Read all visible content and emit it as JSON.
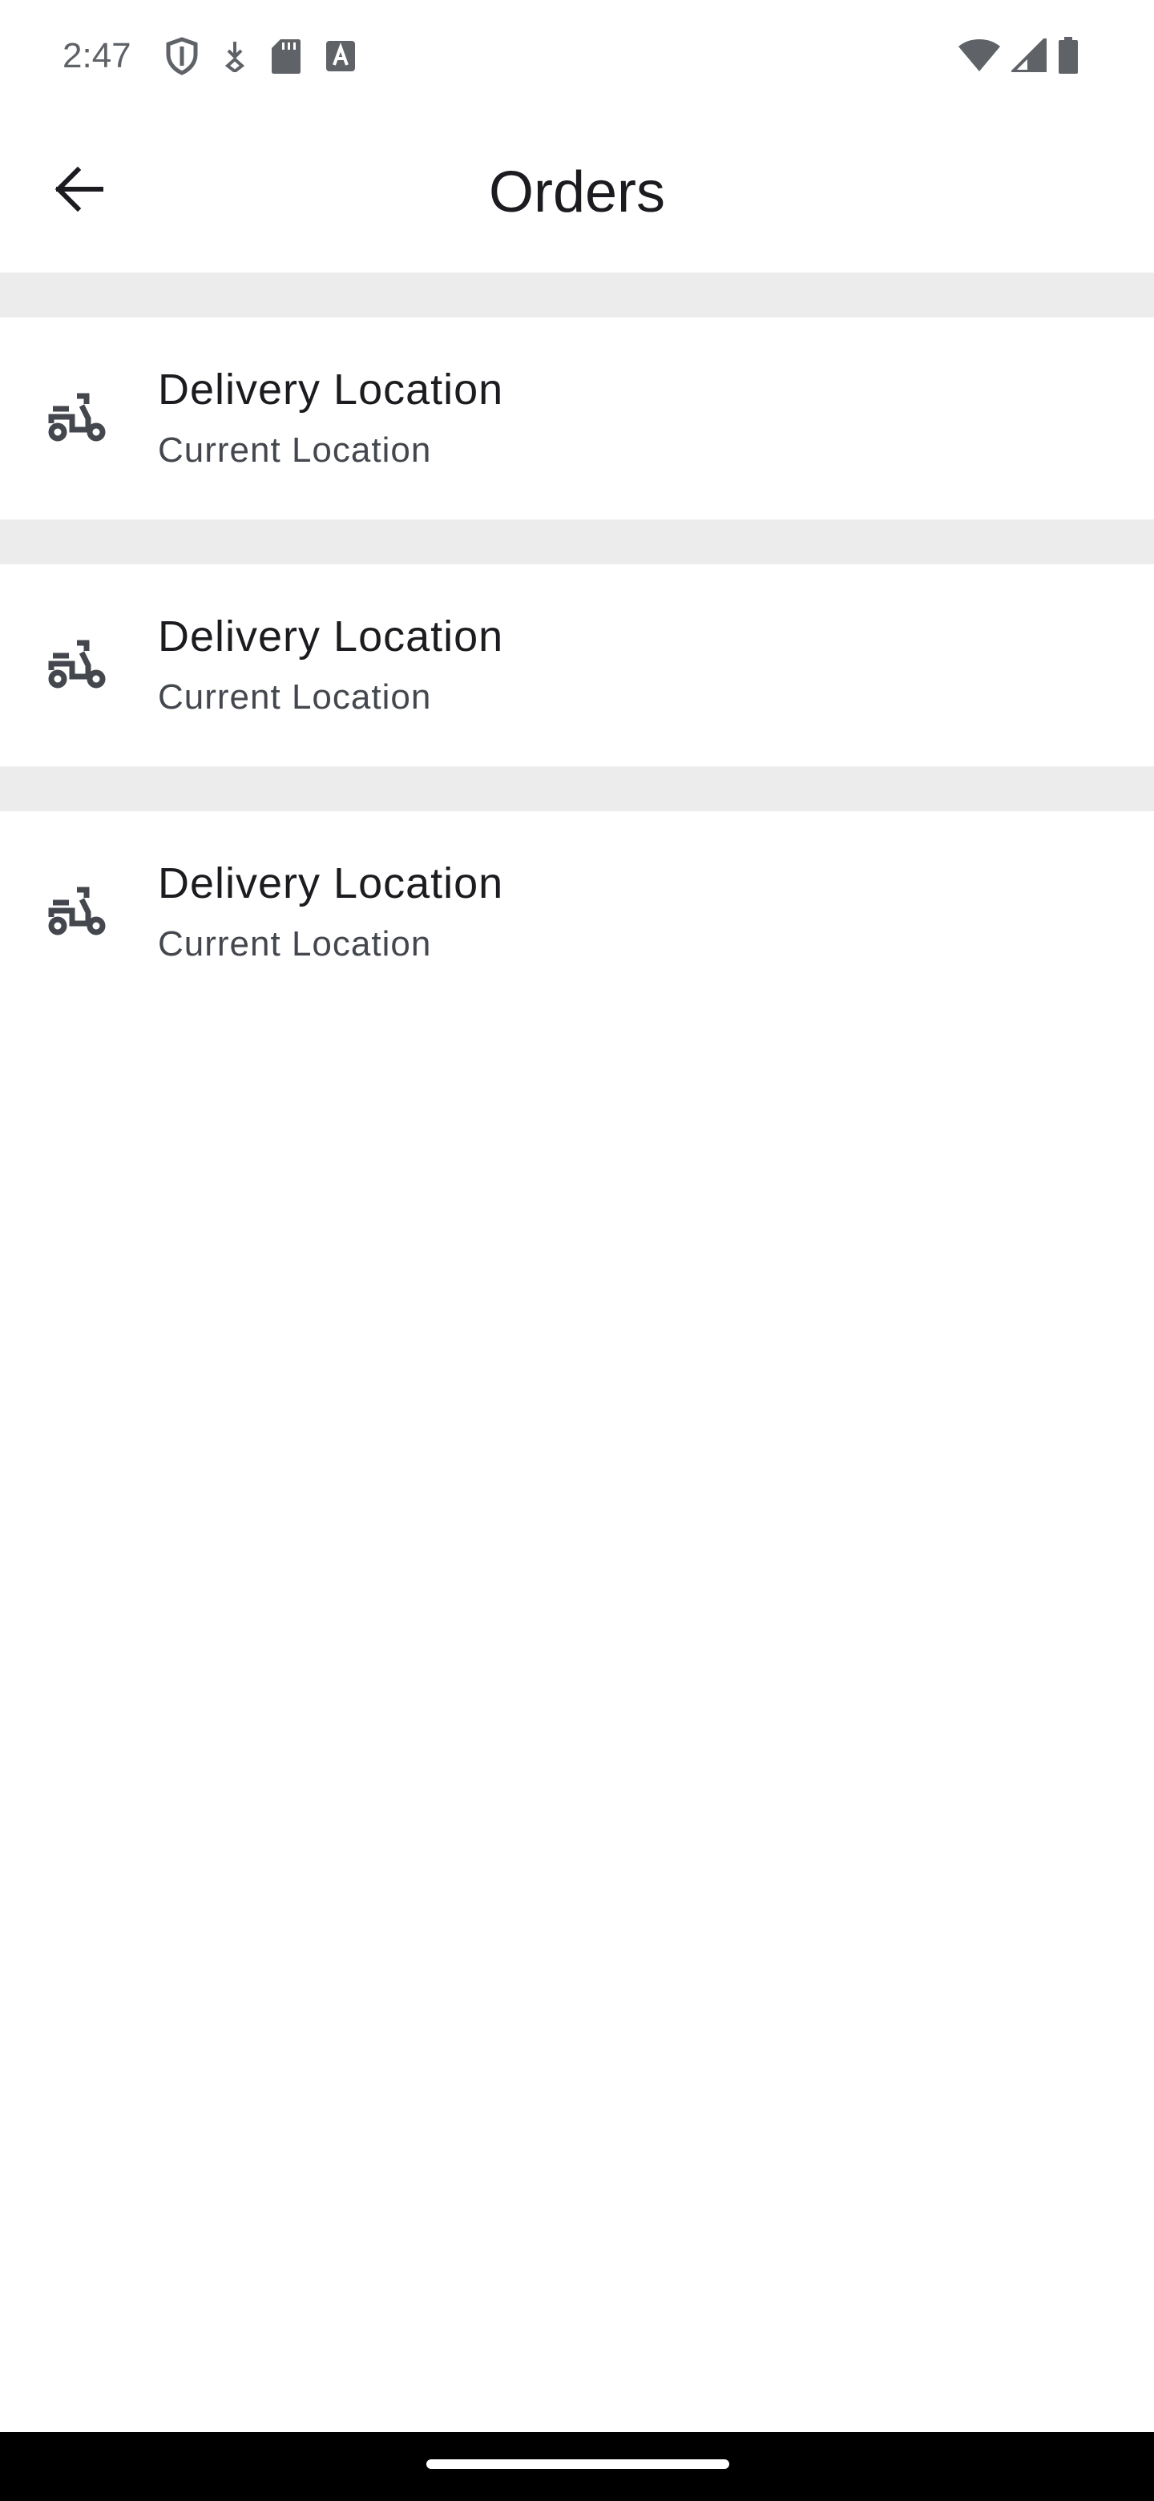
{
  "status_bar": {
    "time": "2:47",
    "left_icons": [
      "shield-icon",
      "download-icon",
      "sd-card-icon",
      "text-a-icon"
    ],
    "right_icons": [
      "wifi-icon",
      "cell-signal-icon",
      "battery-icon"
    ]
  },
  "app_bar": {
    "title": "Orders",
    "back_icon": "arrow-back-icon"
  },
  "orders": [
    {
      "icon": "scooter-icon",
      "title": "Delivery Location",
      "subtitle": "Current Location"
    },
    {
      "icon": "scooter-icon",
      "title": "Delivery Location",
      "subtitle": "Current Location"
    },
    {
      "icon": "scooter-icon",
      "title": "Delivery Location",
      "subtitle": "Current Location"
    }
  ],
  "colors": {
    "separator": "#ececec",
    "text_primary": "#1c1b1f",
    "text_secondary": "#44474e",
    "icon": "#44474e"
  }
}
